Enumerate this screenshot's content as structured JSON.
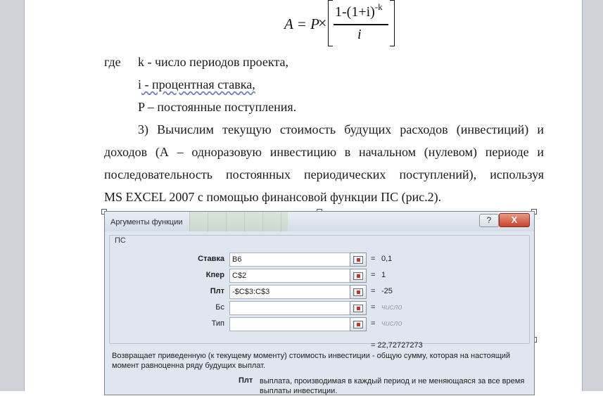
{
  "formula": {
    "lhs": "A = P",
    "times": "×",
    "numerator_base": "1-(1+i)",
    "numerator_exp": "-k",
    "denominator": "i"
  },
  "text": {
    "where_label": "где",
    "def_k": "k - число периодов проекта,",
    "def_i_var": "i",
    "def_i_rest": " - процентная ставка,",
    "def_p": "P – постоянные поступления.",
    "para_l1": "3) Вычислим текущую стоимость будущих расходов (инвестиций) и",
    "para_l2": "доходов (А – одноразовую инвестицию в начальном (нулевом) периоде и",
    "para_l3": "последовательность постоянных периодических поступлений), используя",
    "para_l4": "MS EXCEL 2007 с помощью финансовой функции ПС (рис.2)."
  },
  "dialog": {
    "title": "Аргументы функции",
    "help_label": "?",
    "close_label": "X",
    "function_name": "ПС",
    "args": [
      {
        "label": "Ставка",
        "value": "B6",
        "result": "0,1",
        "bold": true
      },
      {
        "label": "Кпер",
        "value": "C$2",
        "result": "1",
        "bold": true
      },
      {
        "label": "Плт",
        "value": "-$C$3:C$3",
        "result": "-25",
        "bold": true
      },
      {
        "label": "Бс",
        "value": "",
        "result": "число",
        "bold": false
      },
      {
        "label": "Тип",
        "value": "",
        "result": "число",
        "bold": false
      }
    ],
    "eq": "=",
    "total": "= 22,72727273",
    "description": "Возвращает приведенную (к текущему моменту) стоимость инвестиции - общую сумму, которая на настоящий момент равноценна ряду будущих выплат.",
    "arg_help_name": "Плт",
    "arg_help_text": "выплата, производимая в каждый период и не меняющаяся за все время выплаты инвестиции."
  }
}
